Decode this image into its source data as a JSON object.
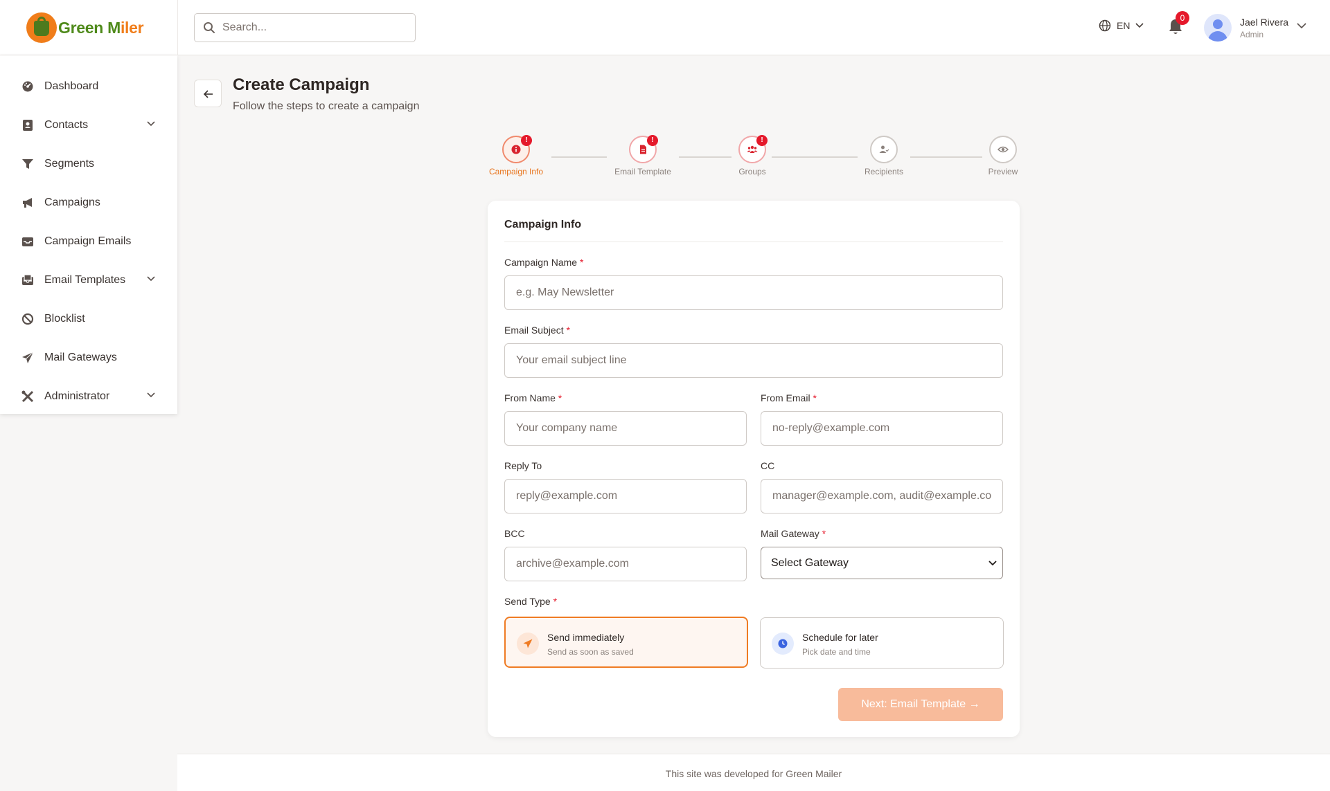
{
  "brand": {
    "part1": "Green M",
    "part2": "iler",
    "accent": "#f07d1a",
    "green": "#4f8a1b"
  },
  "search": {
    "placeholder": "Search..."
  },
  "header": {
    "lang": "EN",
    "notifications": "0",
    "user_name": "Jael Rivera",
    "user_role": "Admin"
  },
  "sidebar": {
    "items": [
      {
        "label": "Dashboard",
        "icon": "dashboard-icon"
      },
      {
        "label": "Contacts",
        "icon": "contacts-icon",
        "expandable": true
      },
      {
        "label": "Segments",
        "icon": "filter-icon"
      },
      {
        "label": "Campaigns",
        "icon": "megaphone-icon"
      },
      {
        "label": "Campaign Emails",
        "icon": "inbox-icon"
      },
      {
        "label": "Email Templates",
        "icon": "template-icon",
        "expandable": true
      },
      {
        "label": "Blocklist",
        "icon": "block-icon"
      },
      {
        "label": "Mail Gateways",
        "icon": "send-icon"
      },
      {
        "label": "Administrator",
        "icon": "tools-icon",
        "expandable": true
      }
    ]
  },
  "page": {
    "title": "Create Campaign",
    "subtitle": "Follow the steps to create a campaign"
  },
  "stepper": {
    "steps": [
      {
        "label": "Campaign Info",
        "state": "active",
        "badge": "!"
      },
      {
        "label": "Email Template",
        "state": "error",
        "badge": "!"
      },
      {
        "label": "Groups",
        "state": "error",
        "badge": "!"
      },
      {
        "label": "Recipients",
        "state": "idle"
      },
      {
        "label": "Preview",
        "state": "idle"
      }
    ]
  },
  "form": {
    "section_title": "Campaign Info",
    "required_mark": "*",
    "campaign_name": {
      "label": "Campaign Name",
      "placeholder": "e.g. May Newsletter",
      "value": ""
    },
    "email_subject": {
      "label": "Email Subject",
      "placeholder": "Your email subject line",
      "value": ""
    },
    "from_name": {
      "label": "From Name",
      "placeholder": "Your company name",
      "value": ""
    },
    "from_email": {
      "label": "From Email",
      "placeholder": "no-reply@example.com",
      "value": ""
    },
    "reply_to": {
      "label": "Reply To",
      "placeholder": "reply@example.com",
      "value": ""
    },
    "cc": {
      "label": "CC",
      "placeholder": "manager@example.com, audit@example.com",
      "value": ""
    },
    "bcc": {
      "label": "BCC",
      "placeholder": "archive@example.com",
      "value": ""
    },
    "mail_gateway": {
      "label": "Mail Gateway",
      "selected": "Select Gateway"
    },
    "send_type": {
      "label": "Send Type",
      "options": [
        {
          "title": "Send immediately",
          "subtitle": "Send as soon as saved",
          "selected": true
        },
        {
          "title": "Schedule for later",
          "subtitle": "Pick date and time",
          "selected": false
        }
      ]
    },
    "next_button": "Next: Email Template →"
  },
  "footer": {
    "text": "This site was developed for Green Mailer"
  }
}
